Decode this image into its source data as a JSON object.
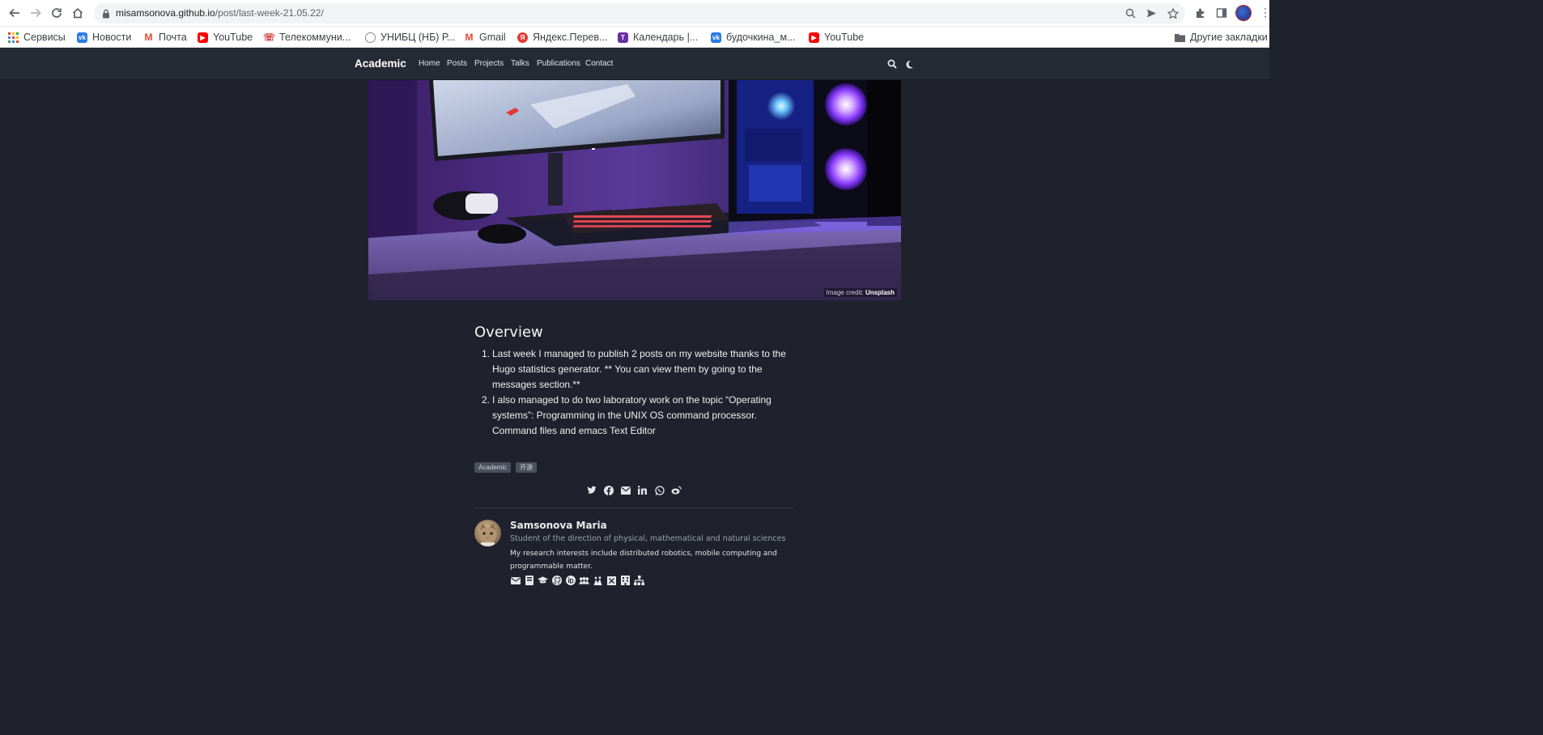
{
  "browser": {
    "url_host": "misamsonova.github.io",
    "url_path": "/post/last-week-21.05.22/"
  },
  "bookmarks": [
    {
      "label": "Сервисы",
      "icon": "apps-icon"
    },
    {
      "label": "Новости",
      "icon": "vk-icon"
    },
    {
      "label": "Почта",
      "icon": "mail-icon"
    },
    {
      "label": "YouTube",
      "icon": "youtube-icon"
    },
    {
      "label": "Телекоммуни...",
      "icon": "telecom-icon"
    },
    {
      "label": "УНИБЦ (НБ) Р...",
      "icon": "library-icon"
    },
    {
      "label": "Gmail",
      "icon": "gmail-icon"
    },
    {
      "label": "Яндекс.Перев...",
      "icon": "yandex-icon"
    },
    {
      "label": "Календарь |...",
      "icon": "calendar-icon"
    },
    {
      "label": "будочкина_м...",
      "icon": "vk-icon"
    },
    {
      "label": "YouTube",
      "icon": "youtube-icon"
    }
  ],
  "other_bookmarks": "Другие закладки",
  "site": {
    "brand": "Academic",
    "nav": [
      "Home",
      "Posts",
      "Projects",
      "Talks",
      "Publications",
      "Contact"
    ]
  },
  "hero": {
    "credit_prefix": "Image credit: ",
    "credit_source": "Unsplash"
  },
  "article": {
    "heading": "Overview",
    "items": [
      {
        "num": "1.",
        "text": "Last week I managed to publish 2 posts on my website thanks to the Hugo statistics generator. ** You can view them by going to the messages section.**"
      },
      {
        "num": "2.",
        "text": "I also managed to do two laboratory work on the topic “Operating systems”: Programming in the UNIX OS command processor. Command files and emacs Text Editor"
      }
    ],
    "tags": [
      "Academic",
      "开源"
    ]
  },
  "share_icons": [
    "twitter-icon",
    "facebook-icon",
    "email-icon",
    "linkedin-icon",
    "whatsapp-icon",
    "weibo-icon"
  ],
  "author": {
    "name": "Samsonova Maria",
    "role": "Student of the direction of physical, mathematical and natural sciences",
    "bio": "My research interests include distributed robotics, mobile computing and programmable matter.",
    "links": [
      "envelope-icon",
      "book-icon",
      "graduation-cap-icon",
      "github-icon",
      "orcid-icon",
      "researchgate-icon",
      "scholar-icon",
      "building-icon",
      "network-icon"
    ]
  },
  "colors": {
    "page_bg": "#1f222d",
    "navbar_bg": "#262a35",
    "tag_bg": "#4b4f5b"
  }
}
